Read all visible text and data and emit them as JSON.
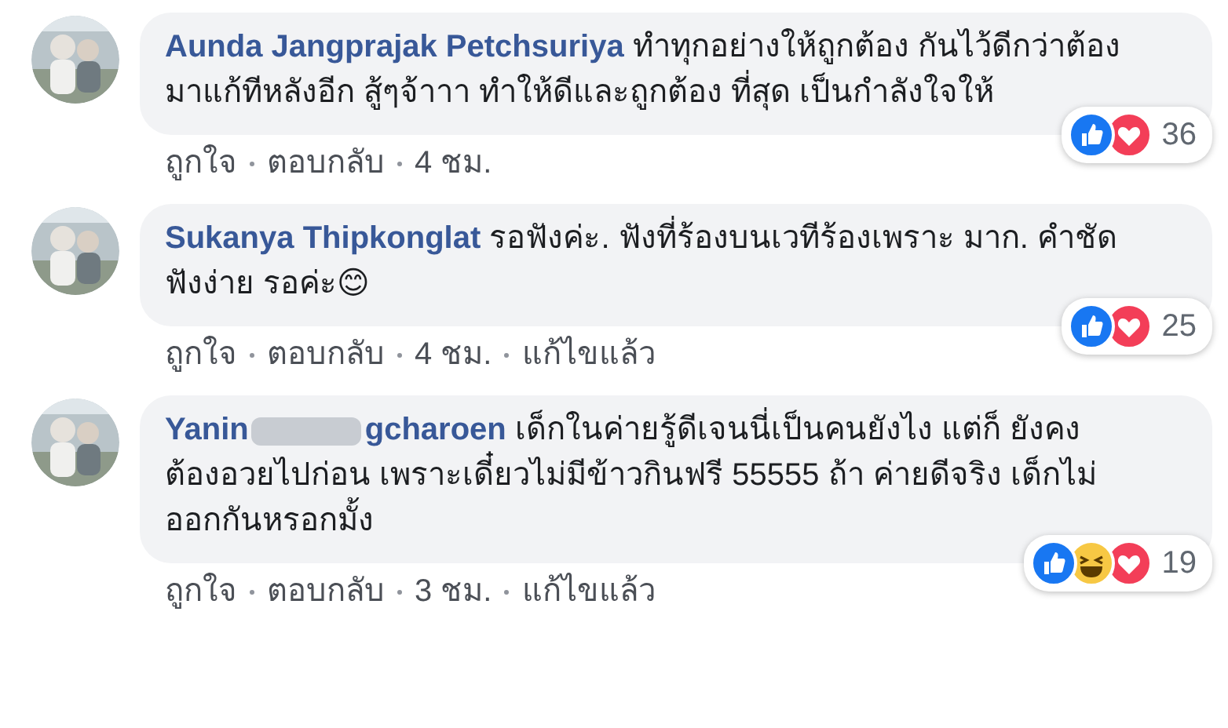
{
  "comments": [
    {
      "name_parts": [
        "Aunda Jangprajak Petchsuriya"
      ],
      "text": "ทำทุกอย่างให้ถูกต้อง กันไว้ดีกว่าต้องมาแก้ทีหลังอีก สู้ๆจ้าาา ทำให้ดีและถูกต้อง ที่สุด เป็นกำลังใจให้",
      "reactions": [
        {
          "kind": "like"
        },
        {
          "kind": "love"
        }
      ],
      "reaction_count": "36",
      "actions": [
        "ถูกใจ",
        "ตอบกลับ",
        "4 ชม."
      ]
    },
    {
      "name_parts": [
        "Sukanya Thipkonglat"
      ],
      "text": "รอฟังค่ะ. ฟังที่ร้องบนเวทีร้องเพราะ มาก. คำชัดฟังง่าย รอค่ะ😊",
      "reactions": [
        {
          "kind": "like"
        },
        {
          "kind": "love"
        }
      ],
      "reaction_count": "25",
      "actions": [
        "ถูกใจ",
        "ตอบกลับ",
        "4 ชม.",
        "แก้ไขแล้ว"
      ]
    },
    {
      "name_parts": [
        "Yanin",
        "gcharoen"
      ],
      "text": "เด็กในค่ายรู้ดีเจนนี่เป็นคนยังไง แต่ก็ ยังคงต้องอวยไปก่อน เพราะเดี๋ยวไม่มีข้าวกินฟรี 55555 ถ้า ค่ายดีจริง เด็กไม่ออกกันหรอกมั้ง",
      "reactions": [
        {
          "kind": "like"
        },
        {
          "kind": "haha"
        },
        {
          "kind": "love"
        }
      ],
      "reaction_count": "19",
      "actions": [
        "ถูกใจ",
        "ตอบกลับ",
        "3 ชม.",
        "แก้ไขแล้ว"
      ]
    }
  ]
}
